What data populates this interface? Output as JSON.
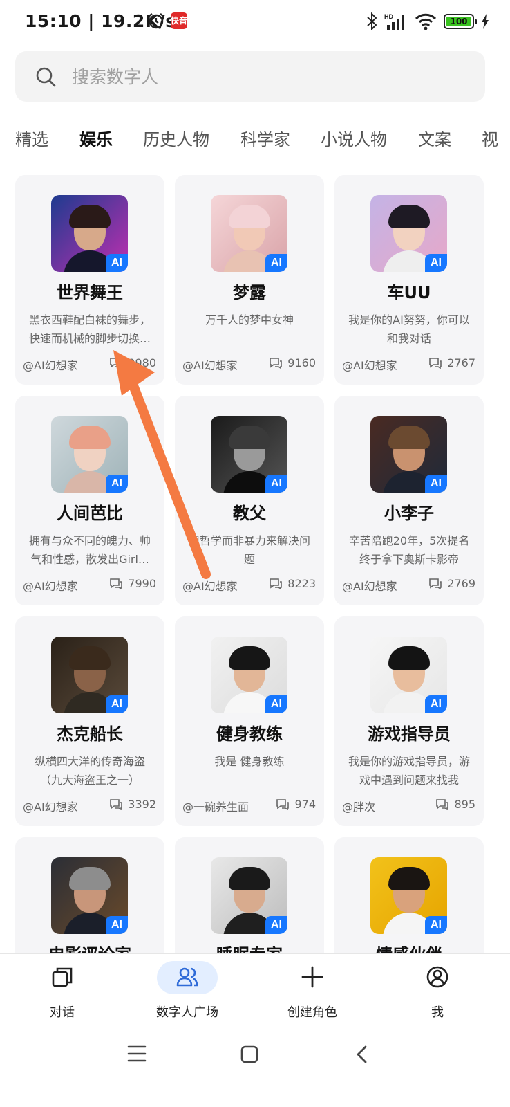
{
  "status": {
    "time": "15:10 | 19.2K/s",
    "app_badge": "快音",
    "battery": "100"
  },
  "search": {
    "placeholder": "搜索数字人"
  },
  "tabs": [
    "精选",
    "娱乐",
    "历史人物",
    "科学家",
    "小说人物",
    "文案",
    "视"
  ],
  "active_tab": "娱乐",
  "ai_badge": "AI",
  "cards": [
    {
      "name": "世界舞王",
      "desc": "黑衣西鞋配白袜的舞步，快速而机械的脚步切换…",
      "author": "@AI幻想家",
      "count": "9980"
    },
    {
      "name": "梦露",
      "desc": "万千人的梦中女神",
      "author": "@AI幻想家",
      "count": "9160"
    },
    {
      "name": "车UU",
      "desc": "我是你的AI努努，你可以和我对话",
      "author": "@AI幻想家",
      "count": "2767"
    },
    {
      "name": "人间芭比",
      "desc": "拥有与众不同的魄力、帅气和性感，散发出Girl…",
      "author": "@AI幻想家",
      "count": "7990"
    },
    {
      "name": "教父",
      "desc": "用哲学而非暴力来解决问题",
      "author": "@AI幻想家",
      "count": "8223"
    },
    {
      "name": "小李子",
      "desc": "辛苦陪跑20年，5次提名终于拿下奥斯卡影帝",
      "author": "@AI幻想家",
      "count": "2769"
    },
    {
      "name": "杰克船长",
      "desc": "纵横四大洋的传奇海盗（九大海盗王之一）",
      "author": "@AI幻想家",
      "count": "3392"
    },
    {
      "name": "健身教练",
      "desc": "我是 健身教练",
      "author": "@一碗养生面",
      "count": "974"
    },
    {
      "name": "游戏指导员",
      "desc": "我是你的游戏指导员，游戏中遇到问题来找我",
      "author": "@胖次",
      "count": "895"
    },
    {
      "name": "电影评论家",
      "desc": "",
      "author": "",
      "count": ""
    },
    {
      "name": "睡眠专家",
      "desc": "",
      "author": "",
      "count": ""
    },
    {
      "name": "情感伙伴",
      "desc": "",
      "author": "",
      "count": ""
    }
  ],
  "nav": {
    "chat": "对话",
    "plaza": "数字人广场",
    "create": "创建角色",
    "me": "我"
  }
}
